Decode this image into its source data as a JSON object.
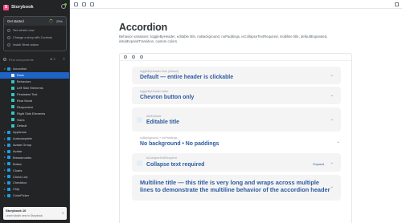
{
  "app": {
    "name": "Storybook",
    "logo_letter": "S"
  },
  "onboarding": {
    "title": "Get started",
    "progress_percent": 25,
    "progress_label": "25%",
    "items": [
      "See what's new",
      "Change a story with Controls",
      "Install Vitest addon"
    ]
  },
  "search": {
    "placeholder": "Find components",
    "shortcut": "⌘ K"
  },
  "tree": [
    {
      "label": "Accordion",
      "level": 0,
      "expanded": true
    },
    {
      "label": "Docs",
      "level": 1,
      "active": true
    },
    {
      "label": "Behaviors",
      "level": 1
    },
    {
      "label": "Left Side Elements",
      "level": 1
    },
    {
      "label": "Persistent Text",
      "level": 1
    },
    {
      "label": "Real World",
      "level": 1
    },
    {
      "label": "Responsive",
      "level": 1
    },
    {
      "label": "Right Side Elements",
      "level": 1
    },
    {
      "label": "Sizes",
      "level": 1
    },
    {
      "label": "Default",
      "level": 1
    },
    {
      "label": "Applicons",
      "level": 0
    },
    {
      "label": "Autocomplete",
      "level": 0
    },
    {
      "label": "Avatar Group",
      "level": 0
    },
    {
      "label": "Avatar",
      "level": 0
    },
    {
      "label": "Breadcrumbs",
      "level": 0
    },
    {
      "label": "Button",
      "level": 0
    },
    {
      "label": "Charts",
      "level": 0
    },
    {
      "label": "Check List",
      "level": 0
    },
    {
      "label": "Checkbox",
      "level": 0
    },
    {
      "label": "Chip",
      "level": 0
    },
    {
      "label": "ColorPicker",
      "level": 0
    }
  ],
  "toast": {
    "title": "Storybook 10",
    "subtitle": "Learn what's new in Storybook"
  },
  "docs": {
    "title": "Accordion",
    "description": "Behavior variations: toggleByHeader, editable title, noBackground, noPaddings, isCollapseTextRequired, multiline title, defaultExpanded, initialExpandTransition, custom colors."
  },
  "accordions": [
    {
      "label": "toggleByHeader=true (default)",
      "header": "Default — entire header is clickable"
    },
    {
      "label": "toggleByHeader=false",
      "header": "Chevron button only"
    },
    {
      "label": "titleEditable",
      "header": "Editable title"
    },
    {
      "label": "noBackground + noPaddings",
      "header": "No background • No paddings"
    },
    {
      "label": "isCollapseTextRequired",
      "header": "Collapse text required",
      "expand_label": "Expand"
    },
    {
      "label": "",
      "header": "Multiline title — this title is very long and wraps across multiple lines to demonstrate the multiline behavior of the accordion header"
    }
  ]
}
